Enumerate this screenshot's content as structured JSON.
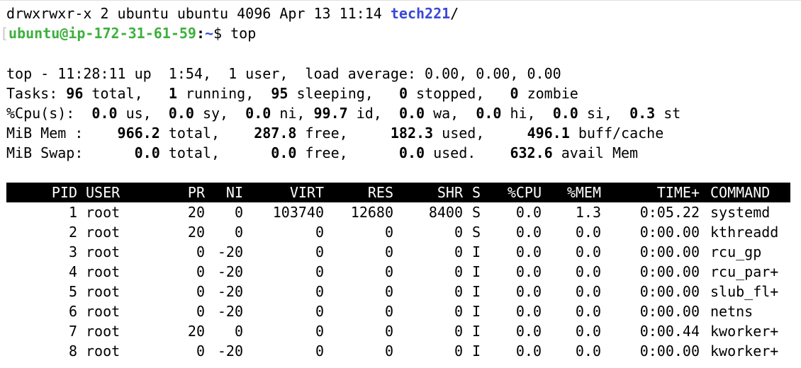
{
  "previous_output": {
    "ls_line_prefix": "drwxrwxr-x 2 ubuntu ubuntu 4096 Apr 13 11:14 ",
    "ls_dirname": "tech221",
    "ls_slash": "/"
  },
  "prompt": {
    "bracket": "[",
    "user_host": "ubuntu@ip-172-31-61-59",
    "colon": ":",
    "path": "~",
    "dollar": "$",
    "command": " top"
  },
  "summary": {
    "line1": "top - 11:28:11 up  1:54,  1 user,  load average: 0.00, 0.00, 0.00",
    "tasks": {
      "label": "Tasks: ",
      "total": "96",
      "total_label": " total,   ",
      "running": "1",
      "running_label": " running,  ",
      "sleeping": "95",
      "sleeping_label": " sleeping,   ",
      "stopped": "0",
      "stopped_label": " stopped,   ",
      "zombie": "0",
      "zombie_label": " zombie"
    },
    "cpu": {
      "label": "%Cpu(s):  ",
      "us": "0.0",
      "us_label": " us,  ",
      "sy": "0.0",
      "sy_label": " sy,  ",
      "ni": "0.0",
      "ni_label": " ni, ",
      "id": "99.7",
      "id_label": " id,  ",
      "wa": "0.0",
      "wa_label": " wa,  ",
      "hi": "0.0",
      "hi_label": " hi,  ",
      "si": "0.0",
      "si_label": " si,  ",
      "st": "0.3",
      "st_label": " st"
    },
    "mem": {
      "label": "MiB Mem :    ",
      "total": "966.2",
      "total_label": " total,    ",
      "free": "287.8",
      "free_label": " free,     ",
      "used": "182.3",
      "used_label": " used,     ",
      "buff": "496.1",
      "buff_label": " buff/cache"
    },
    "swap": {
      "label": "MiB Swap:      ",
      "total": "0.0",
      "total_label": " total,      ",
      "free": "0.0",
      "free_label": " free,      ",
      "used": "0.0",
      "used_label": " used.    ",
      "avail": "632.6",
      "avail_label": " avail Mem"
    }
  },
  "process_table": {
    "headers": {
      "pid": "PID",
      "user": "USER",
      "pr": "PR",
      "ni": "NI",
      "virt": "VIRT",
      "res": "RES",
      "shr": "SHR",
      "s": "S",
      "cpu": "%CPU",
      "mem": "%MEM",
      "time": "TIME+",
      "command": "COMMAND"
    },
    "rows": [
      {
        "pid": "1",
        "user": "root",
        "pr": "20",
        "ni": "0",
        "virt": "103740",
        "res": "12680",
        "shr": "8400",
        "s": "S",
        "cpu": "0.0",
        "mem": "1.3",
        "time": "0:05.22",
        "command": "systemd"
      },
      {
        "pid": "2",
        "user": "root",
        "pr": "20",
        "ni": "0",
        "virt": "0",
        "res": "0",
        "shr": "0",
        "s": "S",
        "cpu": "0.0",
        "mem": "0.0",
        "time": "0:00.00",
        "command": "kthreadd"
      },
      {
        "pid": "3",
        "user": "root",
        "pr": "0",
        "ni": "-20",
        "virt": "0",
        "res": "0",
        "shr": "0",
        "s": "I",
        "cpu": "0.0",
        "mem": "0.0",
        "time": "0:00.00",
        "command": "rcu_gp"
      },
      {
        "pid": "4",
        "user": "root",
        "pr": "0",
        "ni": "-20",
        "virt": "0",
        "res": "0",
        "shr": "0",
        "s": "I",
        "cpu": "0.0",
        "mem": "0.0",
        "time": "0:00.00",
        "command": "rcu_par+"
      },
      {
        "pid": "5",
        "user": "root",
        "pr": "0",
        "ni": "-20",
        "virt": "0",
        "res": "0",
        "shr": "0",
        "s": "I",
        "cpu": "0.0",
        "mem": "0.0",
        "time": "0:00.00",
        "command": "slub_fl+"
      },
      {
        "pid": "6",
        "user": "root",
        "pr": "0",
        "ni": "-20",
        "virt": "0",
        "res": "0",
        "shr": "0",
        "s": "I",
        "cpu": "0.0",
        "mem": "0.0",
        "time": "0:00.00",
        "command": "netns"
      },
      {
        "pid": "7",
        "user": "root",
        "pr": "20",
        "ni": "0",
        "virt": "0",
        "res": "0",
        "shr": "0",
        "s": "I",
        "cpu": "0.0",
        "mem": "0.0",
        "time": "0:00.44",
        "command": "kworker+"
      },
      {
        "pid": "8",
        "user": "root",
        "pr": "0",
        "ni": "-20",
        "virt": "0",
        "res": "0",
        "shr": "0",
        "s": "I",
        "cpu": "0.0",
        "mem": "0.0",
        "time": "0:00.00",
        "command": "kworker+"
      }
    ]
  },
  "colors": {
    "background": "#ffffff",
    "text": "#000000",
    "prompt_user": "#3db03d",
    "prompt_path": "#3a48d6",
    "header_bg": "#000000",
    "header_fg": "#ffffff"
  }
}
